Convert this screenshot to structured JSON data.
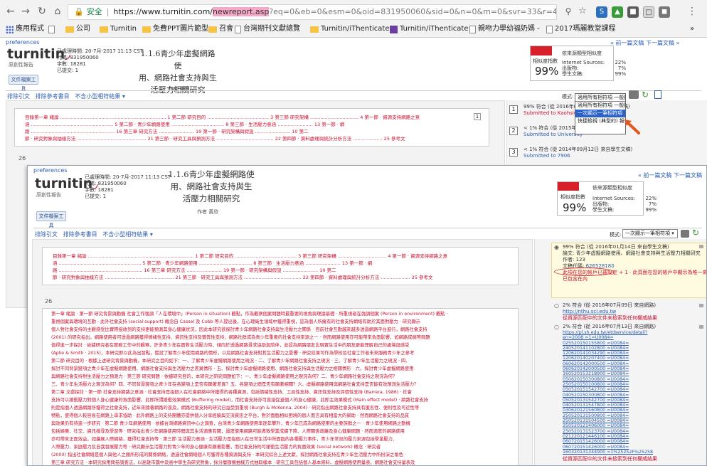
{
  "browser": {
    "secure_label": "安全",
    "url_host": "https://www.turnitin.com/",
    "url_highlight": "newreport.asp",
    "url_rest": "?eq=0&eb=0&esm=0&oid=831950060&sid=0&n=0&m=0&svr=33&r=43.111176180969245&lan",
    "bookmarks": [
      {
        "label": "應用程式",
        "icon": "apps-grid-icon"
      },
      {
        "label": "",
        "icon": "page-icon"
      },
      {
        "label": "公司",
        "icon": "folder-icon"
      },
      {
        "label": "Turnitin",
        "icon": "folder-icon"
      },
      {
        "label": "免費PPT圖片範型",
        "icon": "folder-icon"
      },
      {
        "label": "召會",
        "icon": "folder-icon"
      },
      {
        "label": "台灣期刊文獻總覽",
        "icon": "page-icon"
      },
      {
        "label": "Turnitin/iThenticate",
        "icon": "folder-icon"
      },
      {
        "label": "Turnitin/iThenticate",
        "icon": "purple-square-icon"
      },
      {
        "label": "親吻力學幼福奶媽 -",
        "icon": "page-icon"
      },
      {
        "label": "2017瑪麗教堂課程",
        "icon": "page-icon"
      }
    ],
    "more": "»"
  },
  "report": {
    "preferences": "preferences",
    "logo": "turnitin",
    "logo_sub": "原創性報告",
    "meta_lines": [
      "已處理時間: 20-7月-2017 11:13 CST",
      "代碼: 831950060",
      "字數: 18281",
      "已提交: 1"
    ],
    "title_lines": [
      "1.1.6青少年虛擬網路使",
      "用、網路社會支持與生",
      "活壓力相關研究"
    ],
    "author": "作者 黃欣",
    "download_btn": "文件檔案工具",
    "similarity_heading": "相似度索引",
    "similarity_value": "99%",
    "similarity_label": "相似度指數",
    "similarity_sources_heading": "依來源類型相似度",
    "sources_rows": [
      {
        "label": "Internet Sources:",
        "value": "22%"
      },
      {
        "label": "出版物:",
        "value": "7%"
      },
      {
        "label": "學生文稿:",
        "value": "99%"
      }
    ],
    "top_links": "« 前一篇文稿   下一篇文稿 »",
    "tabs": [
      "排除引文",
      "排除參考書目",
      "不含小型相符結果 ▾"
    ],
    "mode_label": "模式:",
    "mode_value": "一次顯示一筆相符項",
    "dropdown_items": [
      "適用所有相符項 一般顯示",
      "適用所有相符項 一般顯示",
      "一次顯示一筆相符項",
      "快捷檢視 (典型的) 報告"
    ],
    "page_numbers": [
      "1",
      "26"
    ],
    "toc_lines": [
      "目錄第一章 緒論 ........................................................................ 1 第二節 研究目的 .......................................... 3 第三節 研究架構 ................................. 4 第一節 · 資源支持網路之意",
      "涵 ........................................................ 5 第二節 · 青少年網路使用 .................................... 8 第三節 · 生活壓力意涵 ........................ 13 第一節 · 網",
      "路 ......................................................... 16 第三章 研究方法 ........................ 19 第一節 · 研究架構與假設 ........................ 10 第二",
      "節 · 研究對象與抽樣方法 ............................................... 21 第三節 · 研究工具與預測方法 ....................................... 22 第四節 · 資料處理與統計分析方法 .................... 25 參考文"
    ],
    "sources_back": [
      {
        "num": "1",
        "line1": "99% 符合 (從 2016年01月14日 來自學生文稿)",
        "line2": "Submitted to Kaohsiung"
      },
      {
        "num": "2",
        "line1": "< 1% 符合 (從 2015年03月 來自學生文稿)",
        "line2": "Submitted to University"
      },
      {
        "num": "3",
        "line1": "< 1% 符合 (從 2014年09月12日 來自學生文稿)",
        "line2": "Submitted to 7906"
      }
    ]
  },
  "front": {
    "page_num": "26",
    "mode_value": "一次顯示一筆相符項",
    "source_main": {
      "line1": "99% 符合 (從 2016年01月14日 來自學生文稿)",
      "line2": "論文: 青少年虛擬網路使用、網路社會支持與生活壓力相關研究",
      "line3": "作者: 123",
      "id_label": "文稿代碼:",
      "id_value": "626528180",
      "note": "此項在您的帳戶已被設定 + 1 · 此頁面在您的帳戶中顯示為唯一來源且",
      "note2": "已包含在內"
    },
    "source_2": {
      "line1": "2% 符合 (從 2016年07月09日 來自網路)",
      "url": "http://nthu.sci.edu.tw",
      "link": "從資源匹配中的文件未檢索到任何權威結果"
    },
    "source_3": {
      "line1": "2% 符合 (從 2016年07月13日 來自網路)",
      "urls": [
        "https://pl.sh.edu.tw/etdservice/detail?",
        "en=2008&nbsp;=1=U0084=",
        "025520150155800&nbsp;=U0084=",
        "240520141102800&nbsp;=U0084=",
        "120620141034290&nbsp;=U0084=",
        "120620140207400&nbsp;=U0084=",
        "060620142000500&nbsp;=U0084=",
        "060620142000500&nbsp;=U0084=",
        "160520153218900&nbsp;=U0084=",
        "050620150300800&nbsp;=U0084=",
        "250520150100800&nbsp;=U0084=",
        "050520151542700&nbsp;=U0084=",
        "040520150300800&nbsp;=U0084=",
        "050520131542700&nbsp;=U0084=",
        "040520131547800&nbsp;=U0084=",
        "030620121560800&nbsp;=U0084=",
        "250520131500800&nbsp;=U0084=",
        "250520131504500&nbsp;=U0084=",
        "250520121406000&nbsp;=U0084=",
        "250520131523700&nbsp;=U0084=",
        "021220121446100&nbsp;=U0084=",
        "060720151426000&nbsp;=U0084=",
        "060720151426000&nbsp;=U0084=",
        "160320131344900&nbsp;=1%25252F%25258"
      ],
      "link": "從資源匹配中的文件未檢索到任何權威結果"
    },
    "body_lines": [
      "第一章 緒論 · 第一節 研究背景與動機 社會工作強調「人在環境中」(Person in situation) 觀點，作為觀察個案問題時最重要的視角與理論基礎 · 所重視者在強調個案 (Person in environment) 觀點 ·",
      "重視個案與環境的互動 · 此外社會支持 (social support) 概念自 Cassel 及 Cobb 等人提出後，在心理衛生領域中獲得重視，認為個人所擁有的社會支持網絡有助於其面對壓力 · 研究顯示",
      "個人對社會支持的主觀感受比實際接收到的支持更能預測其身心健康狀況，因此本研究欲探討青少年網路社會支持與生活壓力之關係 · 目前社會互動越來越多透過網路平台進行，網路社會支持",
      "(2001) 的研究指出，網路使用者可透過網路獲得情緒性支持、資訊性支持及實質性支持，網路社群成為青少年重要的社會支持來源之一 · 然而網路使用亦可能帶來負面影響，如網路成癮等問題",
      "值得進一步探討 · 依據研究者在實務工作中的觀察，許多青少年在面對生活壓力時，傾向於透過網路尋求協助與陪伴，並認為網路朋友比現實生活中的朋友更能理解自己的處境與感受",
      "(Aplie & Smith · 2015)，本研究即以此為出發點，嘗試了解青少年使用網路的情形，以及網路社會支持對其生活壓力之影響 · 研究結果可作為學校及社會工作者未來服務青少年之參考",
      "第二節 研究目的 · 根據上述研究背景與動機，本研究之目的如下：一、了解青少年虛擬網路使用之現況 · 二、了解青少年網路社會支持之現況 · 三、了解青少年生活壓力之現況 · 四、",
      "探討不同背景變項之青少年在虛擬網路使用、網路社會支持與生活壓力之差異情形 · 五、探討青少年虛擬網路使用、網路社會支持與生活壓力之相關情形 · 六、探討青少年虛擬網路使用",
      "與網路社會支持對生活壓力之預測力 · 第三節 研究問題 · 依據研究目的，本研究之研究問題如下：一、青少年虛擬網路使用之現況為何？二、青少年網路社會支持之現況為何？",
      "三、青少年生活壓力之現況為何？四、不同背景變項之青少年在各變項上是否有顯著差異？五、各變項之間是否有顯著相關？六、虛擬網路使用與網路社會支持是否能有效預測生活壓力？",
      "第二章 文獻探討 · 第一節 社會支持網路之意涵 · 社會支持是指個人在社會網絡中所獲得的各種資源，包括情緒性支持、工具性支持、資訊性支持及評價性支持 (Barrera, 1986) · 社會",
      "支持可以緩衝壓力對個人身心健康的負面影響，此即所謂緩衝效果模式 (Buffering model)，而社會支持亦可直接促進個人的身心健康，此即主效果模式 (Main effect model) · 網路社會支持",
      "則是指個人透過網路所獲得之社會支持，近年來隨著網路的普及，網路社會支持的研究日益受到重視 (Burgh & McKenna, 2004) · 研究指出網路社會支持具有匿名性、便利性及可近性等",
      "特點，使得個人較容易在網路上尋求協助 · 此外網路上的支持團體亦提供個人分享經驗與交流資訊之平台，對於面臨相似困境的個人而言具有相當大的幫助 · 然而網路社會支持的品質",
      "與效果仍有待進一步研究 · 第二節 青少年網路使用 · 依據台灣網路資訊中心之調查，台灣青少年網路使用率逐年攀升，青少年已成為網路使用的主要族群之一 · 青少年使用網路之動機",
      "包括娛樂、社交、資訊搜尋及學習等 · 研究指出青少年網路使用時間與其生活適應有關，過度使用網路可能導致學業成績下降、人際關係疏離及身心健康問題 · 然而適度的網路使用",
      "亦可帶來正面效益，如擴展人際網絡、獲得社會支持等 · 第三節 生活壓力意涵 · 生活壓力是指個人在日常生活中所面臨的各種壓力事件，青少年常見的壓力來源包括學業壓力、",
      "人際壓力、家庭壓力及自我發展壓力等 · 研究顯示生活壓力對青少年的身心健康有顯著影響，而社會支持則可緩衝生活壓力的負面效果 (social network) 概念 · 研究者",
      "(2000) 指出社會網絡是個人與他人之間所形成的關係網絡，透過社會網絡個人可獲得各種資源與支持 · 本研究綜合上述文獻，探討網路社會支持在青少年生活壓力中所扮演之角色 ·",
      "第三章 研究方法 · 本研究採用問卷調查法，以高雄市國中及高中學生為研究對象，採分層隨機抽樣方式抽取樣本 · 研究工具包括個人基本資料、虛擬網路使用量表、網路社會支持量表及",
      "生活壓力量表 · 資料處理與統計分析方法包括描述性統計、獨立樣本 t 檢定、單因子變異數分析、皮爾森積差相關及多元迴歸分析 (何金霖 · 2007) · 研究者並參考 (王美玲 · 2007) 之",
      "研究架構 · 進行本研究之架構設計與假設建立 · Caplan 於 1974 年提出社會支持系統 (Support system) 概念，認為社會支持系統可提供個人所需之協助 · 參考文獻請見附錄"
    ]
  }
}
